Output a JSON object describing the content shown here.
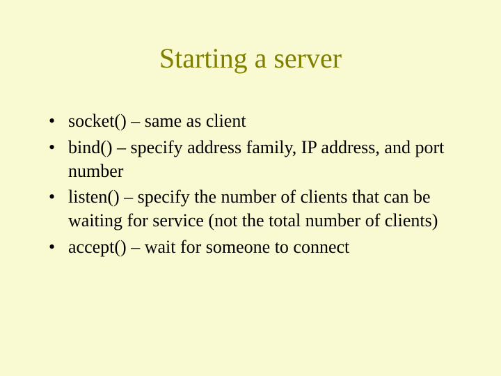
{
  "title": "Starting a server",
  "bullets": [
    "socket() – same as client",
    "bind() – specify address family, IP address, and port number",
    "listen() – specify the number of clients that can be waiting for service (not the total number of clients)",
    "accept() – wait for someone to connect"
  ]
}
